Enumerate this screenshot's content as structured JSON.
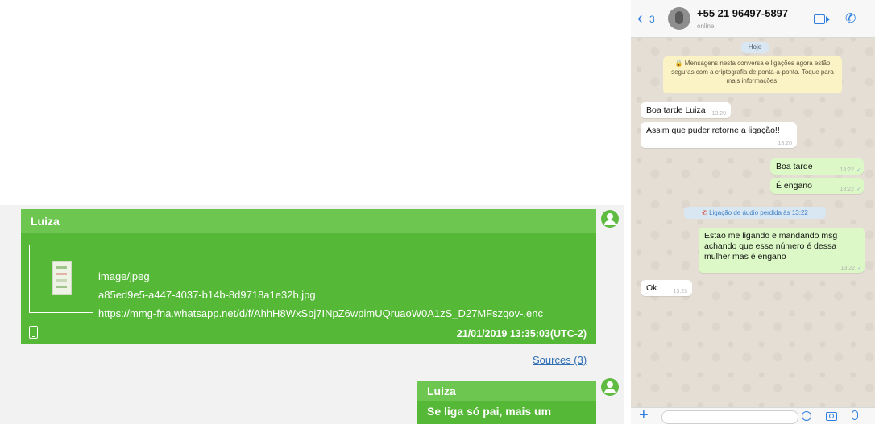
{
  "report": {
    "msg1": {
      "sender": "Luiza",
      "mime": "image/jpeg",
      "filename": "a85ed9e5-a447-4037-b14b-8d9718a1e32b.jpg",
      "url": "https://mmg-fna.whatsapp.net/d/f/AhhH8WxSbj7INpZ6wpimUQruaoW0A1zS_D27MFszqov-.enc",
      "timestamp": "21/01/2019 13:35:03(UTC-2)"
    },
    "sources_link": "Sources (3)",
    "msg2": {
      "sender": "Luiza",
      "text": "Se liga só pai, mais um"
    }
  },
  "phone": {
    "header": {
      "back_count": "3",
      "contact": "+55 21 96497-5897",
      "status": "online"
    },
    "date_pill": "Hoje",
    "encryption_notice": "🔒 Mensagens nesta conversa e ligações agora estão seguras com a criptografia de ponta-a-ponta. Toque para mais informações.",
    "messages": [
      {
        "dir": "in",
        "text": "Boa tarde Luiza",
        "time": "13:20"
      },
      {
        "dir": "in",
        "text": "Assim que puder retorne a ligação!!",
        "time": "13:20"
      },
      {
        "dir": "out",
        "text": "Boa tarde",
        "time": "13:22"
      },
      {
        "dir": "out",
        "text": "É engano",
        "time": "13:22"
      },
      {
        "dir": "out",
        "text": "Estao me ligando e mandando msg achando que esse número é dessa mulher mas é engano",
        "time": "13:22"
      },
      {
        "dir": "in",
        "text": "Ok",
        "time": "13:23"
      }
    ],
    "missed_call": "Ligação de áudio perdida às 13:22",
    "colors": {
      "outgoing": "#dcf8c6",
      "incoming": "#ffffff",
      "accent": "#2f7fe0",
      "report_green": "#55b837"
    }
  }
}
